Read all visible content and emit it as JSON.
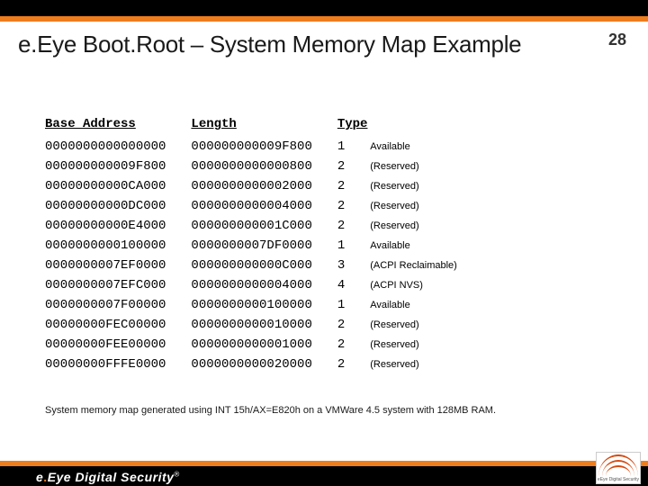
{
  "page": {
    "title": "e.Eye Boot.Root – System Memory Map Example",
    "number": "28",
    "caption": "System memory map generated using INT 15h/AX=E820h on a VMWare 4.5 system with 128MB RAM."
  },
  "headers": {
    "base": "Base Address",
    "length": "Length",
    "type": "Type"
  },
  "rows": [
    {
      "base": "0000000000000000",
      "length": "000000000009F800",
      "tcode": "1",
      "tlabel": "Available"
    },
    {
      "base": "000000000009F800",
      "length": "0000000000000800",
      "tcode": "2",
      "tlabel": "(Reserved)"
    },
    {
      "base": "00000000000CA000",
      "length": "0000000000002000",
      "tcode": "2",
      "tlabel": "(Reserved)"
    },
    {
      "base": "00000000000DC000",
      "length": "0000000000004000",
      "tcode": "2",
      "tlabel": "(Reserved)"
    },
    {
      "base": "00000000000E4000",
      "length": "000000000001C000",
      "tcode": "2",
      "tlabel": "(Reserved)"
    },
    {
      "base": "0000000000100000",
      "length": "0000000007DF0000",
      "tcode": "1",
      "tlabel": "Available"
    },
    {
      "base": "0000000007EF0000",
      "length": "000000000000C000",
      "tcode": "3",
      "tlabel": "(ACPI Reclaimable)"
    },
    {
      "base": "0000000007EFC000",
      "length": "0000000000004000",
      "tcode": "4",
      "tlabel": "(ACPI NVS)"
    },
    {
      "base": "0000000007F00000",
      "length": "0000000000100000",
      "tcode": "1",
      "tlabel": "Available"
    },
    {
      "base": "00000000FEC00000",
      "length": "0000000000010000",
      "tcode": "2",
      "tlabel": "(Reserved)"
    },
    {
      "base": "00000000FEE00000",
      "length": "0000000000001000",
      "tcode": "2",
      "tlabel": "(Reserved)"
    },
    {
      "base": "00000000FFFE0000",
      "length": "0000000000020000",
      "tcode": "2",
      "tlabel": "(Reserved)"
    }
  ],
  "brand": {
    "text1": "e",
    "dot": ".",
    "text2": "Eye Digital Security",
    "reg": "®",
    "logotext": "eEye Digital Security"
  }
}
